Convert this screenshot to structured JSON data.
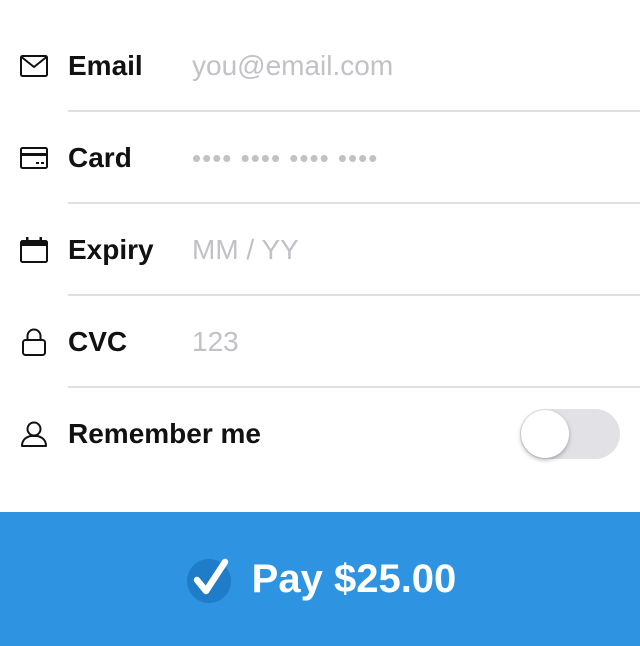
{
  "form": {
    "email": {
      "label": "Email",
      "placeholder": "you@email.com",
      "value": "",
      "icon": "envelope-icon"
    },
    "card": {
      "label": "Card",
      "placeholder": "•••• •••• •••• ••••",
      "value": "",
      "icon": "credit-card-icon"
    },
    "expiry": {
      "label": "Expiry",
      "placeholder": "MM / YY",
      "value": "",
      "icon": "calendar-icon"
    },
    "cvc": {
      "label": "CVC",
      "placeholder": "123",
      "value": "",
      "icon": "lock-icon"
    },
    "remember": {
      "label": "Remember me",
      "icon": "user-icon",
      "enabled": false
    }
  },
  "pay_button": {
    "label": "Pay $25.00",
    "icon": "checkmark-icon"
  },
  "colors": {
    "accent": "#2e93e0",
    "placeholder": "#c1c1c7",
    "divider": "#e0e0e4",
    "toggle_off": "#e1e1e6",
    "text": "#111111"
  }
}
